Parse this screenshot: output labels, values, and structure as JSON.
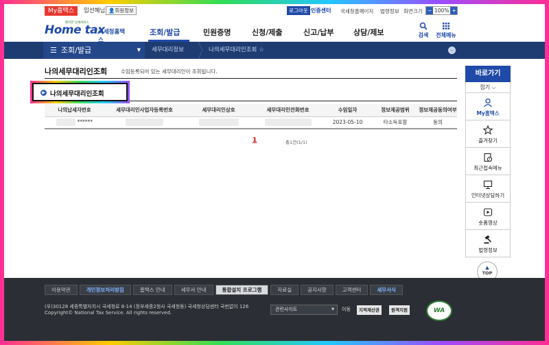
{
  "util": {
    "my_hometax": "My홈택스",
    "user_name": "임선혜님",
    "member_info": "회원정보",
    "logout": "로그아웃",
    "cert_center": "인증센터",
    "nts_home": "국세청홈페이지",
    "law_info": "법령정보",
    "screen_size": "화면크기",
    "zoom_minus": "−",
    "zoom_value": "100%",
    "zoom_plus": "+"
  },
  "header": {
    "logo_main": "Home tax",
    "logo_sub": "국세청홈택스",
    "logo_tiny": "편리한 납세서비스",
    "nav": [
      "조회/발급",
      "민원증명",
      "신청/제출",
      "신고/납부",
      "상담/제보"
    ],
    "active_nav": "조회/발급",
    "search_label": "검색",
    "allmenu_label": "전체메뉴"
  },
  "location": {
    "first": "조회/발급",
    "second": "세무대리정보",
    "third": "나의세무대리인조회"
  },
  "page": {
    "title": "나의세무대리인조회",
    "description": "수임등록되어 있는 세무대리인이 조회됩니다.",
    "section_title": "나의세무대리인조회"
  },
  "table": {
    "headers": [
      "나의납세자번호",
      "세무대리인사업자등록번호",
      "세무대리인상호",
      "세무대리인전화번호",
      "수임일자",
      "정보제공범위",
      "정보제공동의여부"
    ],
    "rows": [
      {
        "taxpayer_no": "******",
        "biz_no": "",
        "firm_name": "",
        "phone": "",
        "date": "2023-05-10",
        "scope": "타소득포함",
        "consent": "동의"
      }
    ]
  },
  "pagination": {
    "current": "1",
    "total": "총1건(1/1)"
  },
  "quick": {
    "title": "바로가기",
    "fold": "접기 ⌵",
    "items": [
      {
        "label": "My홈택스",
        "icon": "user-icon"
      },
      {
        "label": "즐겨찾기",
        "icon": "star-icon"
      },
      {
        "label": "최근접속메뉴",
        "icon": "recent-icon"
      },
      {
        "label": "인터넷상담하기",
        "icon": "chat-icon"
      },
      {
        "label": "숏폼영상",
        "icon": "play-icon"
      },
      {
        "label": "법령정보",
        "icon": "gavel-icon"
      }
    ],
    "top": "TOP"
  },
  "footer": {
    "links": [
      "이용약관",
      "개인정보처리방침",
      "홈택스 안내",
      "세무서 안내",
      "통합설치 프로그램",
      "자료실",
      "공지사항",
      "고객센터",
      "세무서식"
    ],
    "address": "(우)30128 세종특별자치시 국세청로 8-14 (정부세종2청사 국세청동) 국세청상담센터 국번없이 126",
    "copyright": "Copyright© National Tax Service. All rights reserved.",
    "related_site": "관련사이트",
    "move": "이동",
    "btn1": "지적재산권",
    "btn2": "원격지원",
    "badge": "WA"
  },
  "colors": {
    "brand": "#1f4aa8",
    "locbar": "#1e3c72",
    "footer": "#2b2f35",
    "my_red": "#e8372f"
  }
}
